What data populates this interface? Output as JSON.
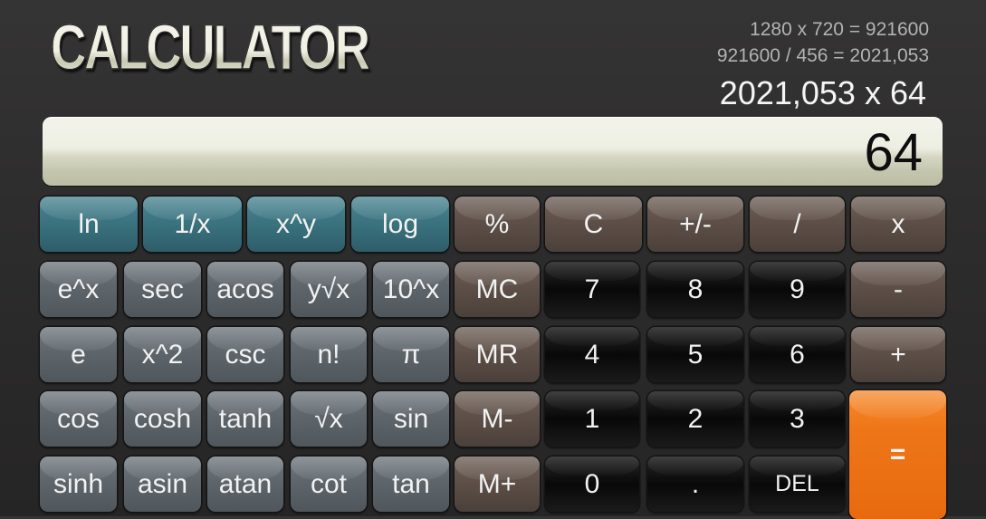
{
  "app": {
    "title": "CALCULATOR"
  },
  "history": [
    "1280 x 720 = 921600",
    "921600 / 456 = 2021,053"
  ],
  "expression": "2021,053 x 64",
  "display": {
    "value": "64"
  },
  "keys": {
    "ln": "ln",
    "inv": "1/x",
    "pow": "x^y",
    "log": "log",
    "percent": "%",
    "clear": "C",
    "negate": "+/-",
    "divide": "/",
    "multiply": "x",
    "exp": "e^x",
    "sec": "sec",
    "acos": "acos",
    "yroot": "y√x",
    "pow10": "10^x",
    "mc": "MC",
    "d7": "7",
    "d8": "8",
    "d9": "9",
    "minus": "-",
    "e": "e",
    "square": "x^2",
    "csc": "csc",
    "fact": "n!",
    "pi": "π",
    "mr": "MR",
    "d4": "4",
    "d5": "5",
    "d6": "6",
    "plus": "+",
    "cos": "cos",
    "cosh": "cosh",
    "tanh": "tanh",
    "sqrt": "√x",
    "sin": "sin",
    "mminus": "M-",
    "d1": "1",
    "d2": "2",
    "d3": "3",
    "equals": "=",
    "sinh": "sinh",
    "asin": "asin",
    "atan": "atan",
    "cot": "cot",
    "tan": "tan",
    "mplus": "M+",
    "d0": "0",
    "dot": ".",
    "del": "DEL"
  },
  "colors": {
    "teal": "#3b7480",
    "gray": "#5e656b",
    "brown": "#5e5048",
    "black": "#111111",
    "orange": "#ee7618",
    "display": "#eeefe3"
  }
}
